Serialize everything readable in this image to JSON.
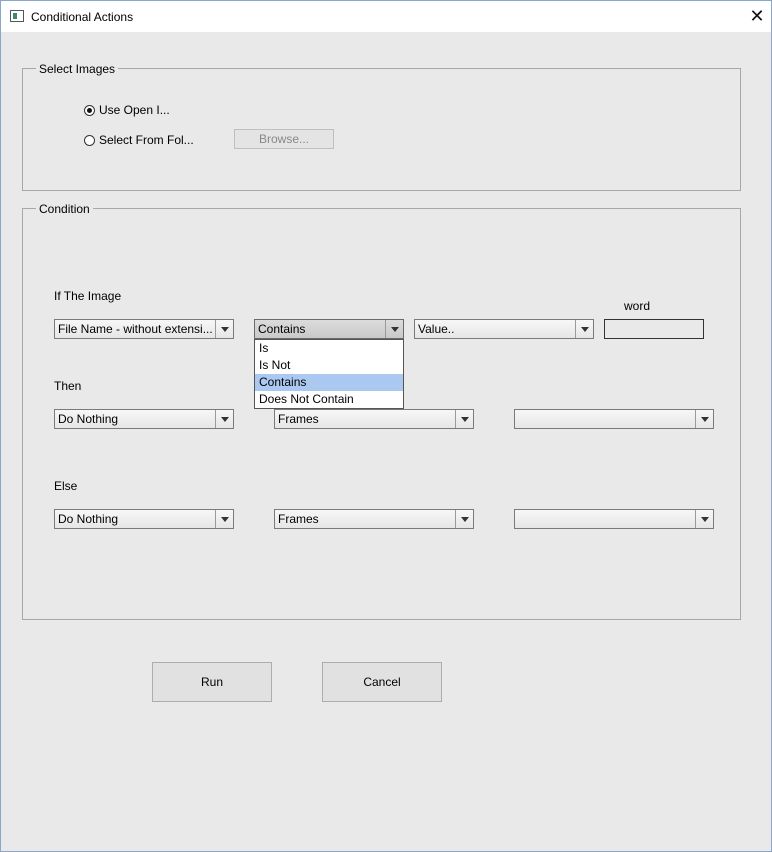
{
  "window": {
    "title": "Conditional Actions",
    "close_glyph": "✕"
  },
  "select_images": {
    "legend": "Select Images",
    "use_open": "Use Open I...",
    "select_from_folder": "Select From Fol...",
    "browse": "Browse...",
    "selected": "use_open"
  },
  "condition": {
    "legend": "Condition",
    "if_label": "If The Image",
    "if_combo": "File Name - without extensi...",
    "operator_combo": "Contains",
    "value_combo": "Value..",
    "word_label": "word",
    "word_value": "",
    "operator_options": [
      "Is",
      "Is Not",
      "Contains",
      "Does Not Contain"
    ],
    "operator_selected": "Contains",
    "then_label": "Then",
    "then_action": "Do Nothing",
    "then_target": "Frames",
    "then_extra": "",
    "else_label": "Else",
    "else_action": "Do Nothing",
    "else_target": "Frames",
    "else_extra": ""
  },
  "buttons": {
    "run": "Run",
    "cancel": "Cancel"
  }
}
